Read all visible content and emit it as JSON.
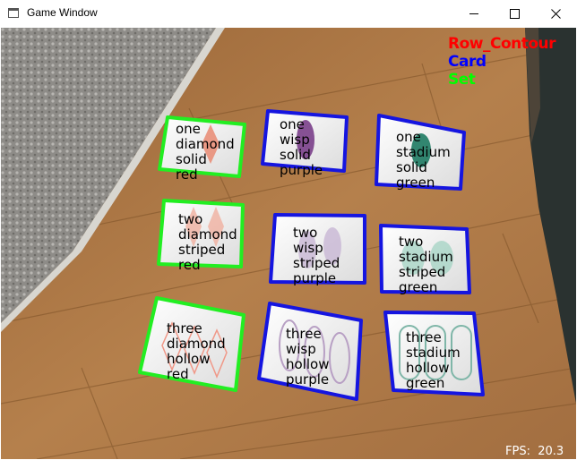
{
  "window": {
    "title": "Game Window",
    "icon": "app-window-icon",
    "controls": {
      "minimize": "minimize-icon",
      "maximize": "maximize-icon",
      "close": "close-icon"
    }
  },
  "legend": {
    "row_contour": {
      "label": "Row_Contour",
      "color": "#ff0000"
    },
    "card": {
      "label": "Card",
      "color": "#0000ff"
    },
    "set": {
      "label": "Set",
      "color": "#00ff00"
    }
  },
  "fps": {
    "label": "FPS:",
    "value": "20.3"
  },
  "colors": {
    "card_outline": "#1515e0",
    "set_outline": "#22ee22",
    "floor": "#b07a48",
    "rug": "#8c8a86"
  },
  "cards": [
    {
      "lines": [
        "one",
        "diamond",
        "solid",
        "red"
      ],
      "outline": "set"
    },
    {
      "lines": [
        "one",
        "wisp",
        "solid",
        "purple"
      ],
      "outline": "card"
    },
    {
      "lines": [
        "one",
        "stadium",
        "solid",
        "green"
      ],
      "outline": "card"
    },
    {
      "lines": [
        "two",
        "diamond",
        "striped",
        "red"
      ],
      "outline": "set"
    },
    {
      "lines": [
        "two",
        "wisp",
        "striped",
        "purple"
      ],
      "outline": "card"
    },
    {
      "lines": [
        "two",
        "stadium",
        "striped",
        "green"
      ],
      "outline": "card"
    },
    {
      "lines": [
        "three",
        "diamond",
        "hollow",
        "red"
      ],
      "outline": "set"
    },
    {
      "lines": [
        "three",
        "wisp",
        "hollow",
        "purple"
      ],
      "outline": "card"
    },
    {
      "lines": [
        "three",
        "stadium",
        "hollow",
        "green"
      ],
      "outline": "card"
    }
  ]
}
